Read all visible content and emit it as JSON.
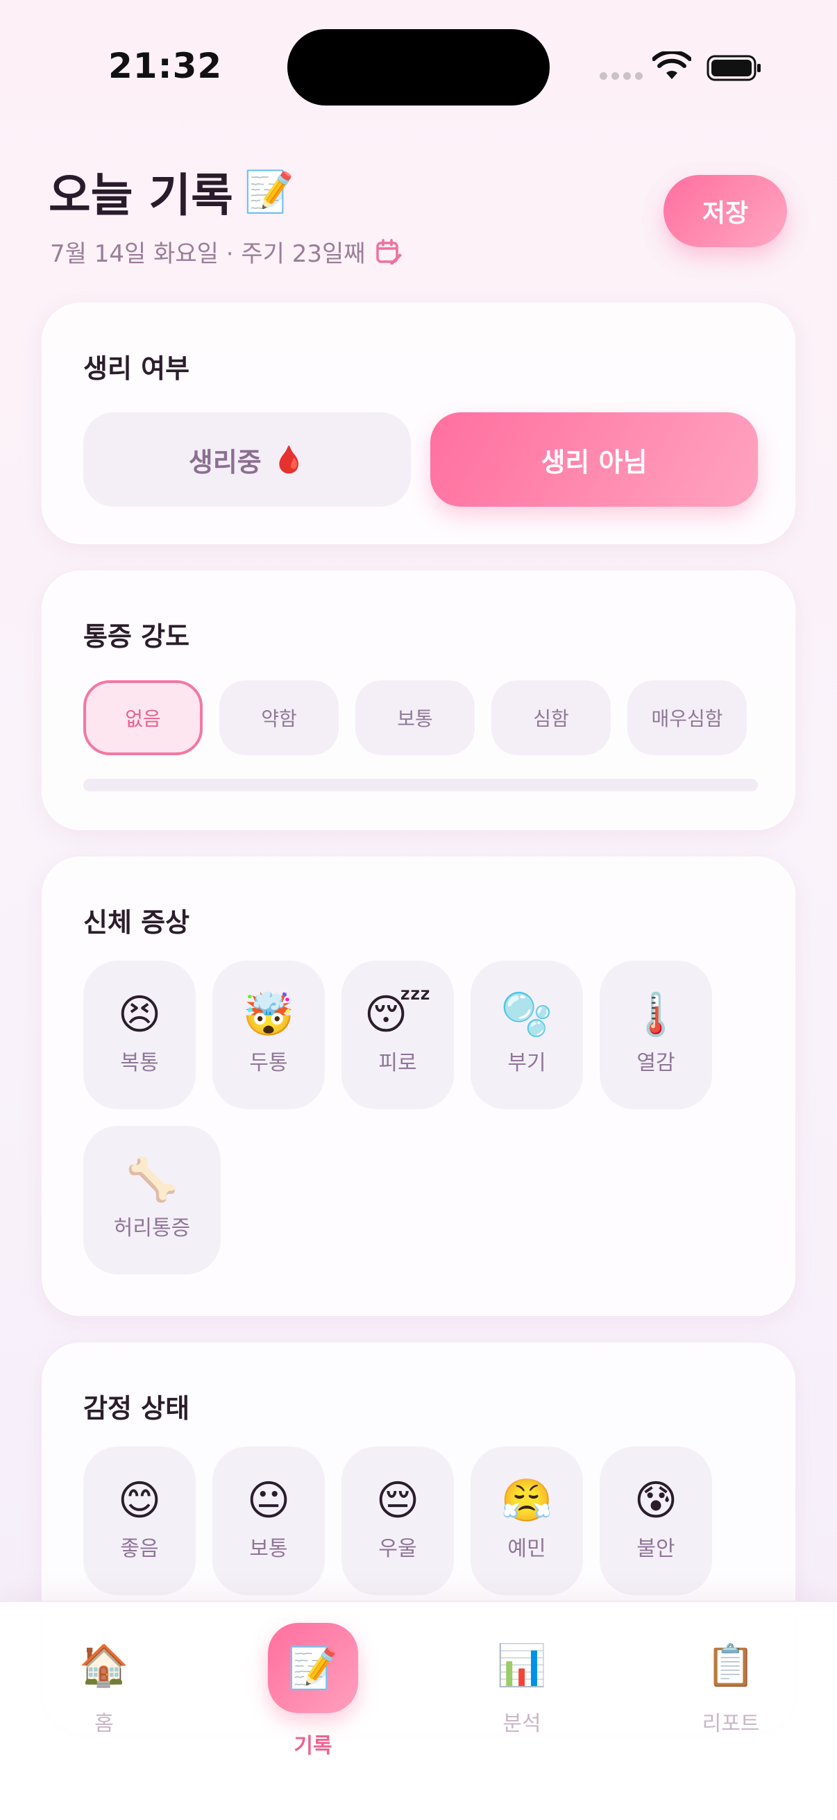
{
  "status_bar": {
    "time": "21:32"
  },
  "header": {
    "title": "오늘 기록",
    "title_emoji": "📝",
    "subtitle": "7월 14일 화요일 · 주기 23일째",
    "save_label": "저장"
  },
  "period": {
    "title": "생리 여부",
    "on_label": "생리중",
    "on_emoji": "🩸",
    "off_label": "생리 아님",
    "selected": "생리 아님"
  },
  "pain": {
    "title": "통증 강도",
    "levels": [
      "없음",
      "약함",
      "보통",
      "심함",
      "매우심함"
    ],
    "selected": "없음",
    "level_fraction": 0
  },
  "symptoms": {
    "title": "신체 증상",
    "items": [
      {
        "emoji": "😣",
        "label": "복통"
      },
      {
        "emoji": "🤯",
        "label": "두통"
      },
      {
        "emoji": "😴",
        "label": "피로"
      },
      {
        "emoji": "🫧",
        "label": "부기"
      },
      {
        "emoji": "🌡️",
        "label": "열감"
      },
      {
        "emoji": "🦴",
        "label": "허리통증"
      }
    ]
  },
  "mood": {
    "title": "감정 상태",
    "items": [
      {
        "emoji": "😊",
        "label": "좋음"
      },
      {
        "emoji": "😐",
        "label": "보통"
      },
      {
        "emoji": "😔",
        "label": "우울"
      },
      {
        "emoji": "😤",
        "label": "예민"
      },
      {
        "emoji": "😰",
        "label": "불안"
      }
    ]
  },
  "nav": {
    "items": [
      {
        "emoji": "🏠",
        "label": "홈"
      },
      {
        "emoji": "📝",
        "label": "기록"
      },
      {
        "emoji": "📊",
        "label": "분석"
      },
      {
        "emoji": "📋",
        "label": "리포트"
      }
    ],
    "active": "기록"
  },
  "colors": {
    "accent": "#ff6f9f",
    "accent_light": "#ffa7c3",
    "chip_bg": "#f4eff7",
    "muted_text": "#8f7598"
  }
}
